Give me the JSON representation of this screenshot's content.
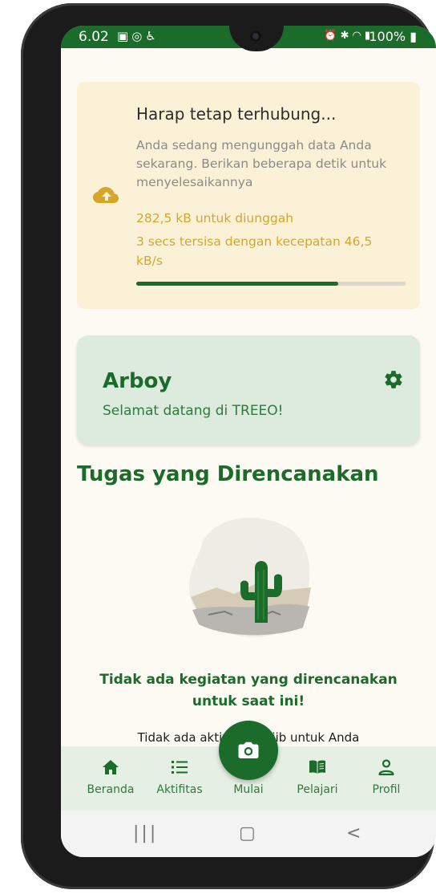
{
  "status_bar": {
    "time": "6.02",
    "battery": "100%",
    "left_icons": [
      "gallery-icon",
      "whatsapp-icon",
      "accessibility-icon"
    ],
    "right_icons": [
      "alarm-icon",
      "bluetooth-icon",
      "wifi-icon",
      "signal-icon",
      "battery-icon"
    ]
  },
  "upload": {
    "title": "Harap tetap terhubung...",
    "description": "Anda sedang mengunggah data Anda sekarang. Berikan beberapa detik untuk menyelesaikannya",
    "size": "282,5 kB untuk diunggah",
    "eta": "3 secs tersisa dengan kecepatan 46,5 kB/s",
    "progress": 0.75,
    "icon": "cloud-upload-icon",
    "accent": "#d4a72c"
  },
  "welcome": {
    "name": "Arboy",
    "message": "Selamat datang di TREEO!",
    "settings_icon": "gear-icon"
  },
  "tasks": {
    "title": "Tugas yang Direncanakan",
    "empty_title": "Tidak ada kegiatan yang direncanakan untuk saat ini!",
    "empty_desc": "Tidak ada aktivitas wajib untuk Anda"
  },
  "bottom_nav": {
    "items": [
      {
        "label": "Beranda",
        "icon": "home-icon"
      },
      {
        "label": "Aktifitas",
        "icon": "list-icon"
      },
      {
        "label": "Mulai",
        "icon": "camera-icon"
      },
      {
        "label": "Pelajari",
        "icon": "book-icon"
      },
      {
        "label": "Profil",
        "icon": "person-icon"
      }
    ]
  },
  "colors": {
    "brand": "#1b6b2a",
    "upload_card": "#fbf1d6",
    "welcome_card": "#dcebde",
    "background": "#fcfaf3"
  }
}
